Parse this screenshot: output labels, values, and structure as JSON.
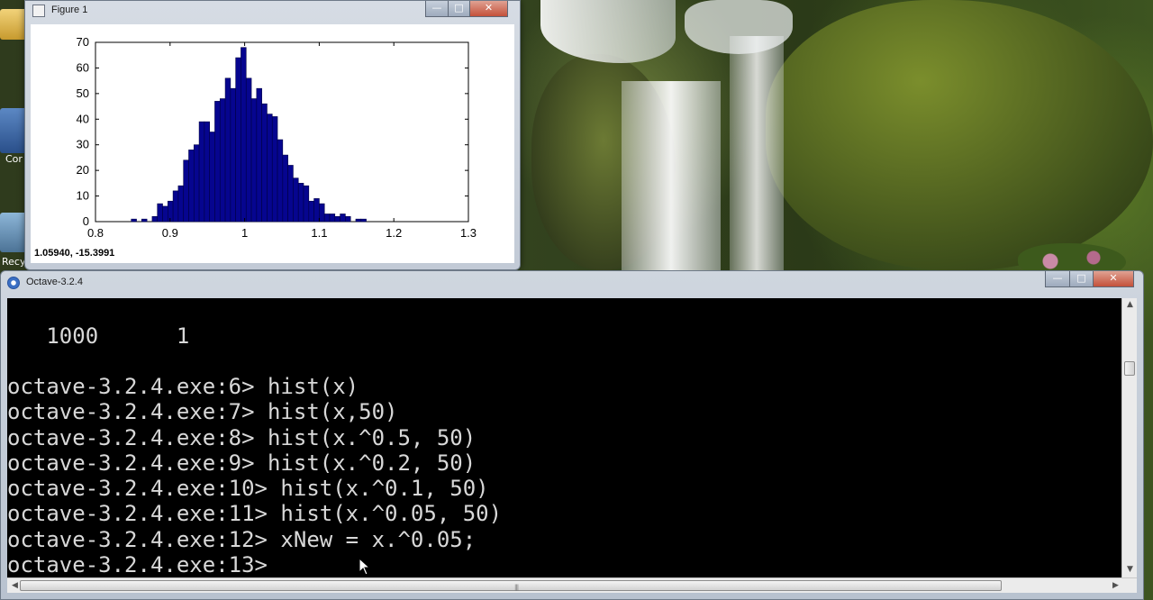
{
  "figure_window": {
    "title": "Figure 1",
    "minimize_glyph": "—",
    "maximize_glyph": "□",
    "close_glyph": "✕",
    "coordinates": "1.05940, -15.3991",
    "icon": "figure-icon"
  },
  "octave_window": {
    "title": "Octave-3.2.4",
    "minimize_glyph": "—",
    "maximize_glyph": "□",
    "close_glyph": "✕",
    "icon": "octave-icon",
    "lines": [
      "   1000      1",
      "",
      "octave-3.2.4.exe:6> hist(x)",
      "octave-3.2.4.exe:7> hist(x,50)",
      "octave-3.2.4.exe:8> hist(x.^0.5, 50)",
      "octave-3.2.4.exe:9> hist(x.^0.2, 50)",
      "octave-3.2.4.exe:10> hist(x.^0.1, 50)",
      "octave-3.2.4.exe:11> hist(x.^0.05, 50)",
      "octave-3.2.4.exe:12> xNew = x.^0.05;",
      "octave-3.2.4.exe:13> "
    ],
    "scroll_up_glyph": "▲",
    "scroll_down_glyph": "▼",
    "scroll_left_glyph": "◀",
    "scroll_right_glyph": "▶",
    "grip_glyph": "|||"
  },
  "desktop": {
    "icon_labels": [
      "Cor",
      "Recy"
    ]
  },
  "colors": {
    "bar_fill": "#06058f",
    "bar_edge": "#000044",
    "terminal_bg": "#000000",
    "terminal_fg": "#d8d8d8"
  },
  "chart_data": {
    "type": "bar",
    "title": "",
    "xlabel": "",
    "ylabel": "",
    "xlim": [
      0.8,
      1.3
    ],
    "ylim": [
      0,
      70
    ],
    "xticks": [
      "0.8",
      "0.9",
      "1",
      "1.1",
      "1.2",
      "1.3"
    ],
    "xtick_values": [
      0.8,
      0.9,
      1.0,
      1.1,
      1.2,
      1.3
    ],
    "yticks": [
      "0",
      "10",
      "20",
      "30",
      "40",
      "50",
      "60",
      "70"
    ],
    "ytick_values": [
      0,
      10,
      20,
      30,
      40,
      50,
      60,
      70
    ],
    "grid": false,
    "bin_start": 0.82,
    "bin_width": 0.007,
    "values": [
      0,
      0,
      0,
      0,
      1,
      0,
      1,
      0,
      2,
      7,
      6,
      8,
      12,
      14,
      24,
      28,
      30,
      39,
      39,
      35,
      47,
      48,
      56,
      52,
      64,
      68,
      56,
      48,
      52,
      46,
      42,
      41,
      32,
      26,
      22,
      17,
      15,
      14,
      8,
      9,
      7,
      3,
      3,
      2,
      3,
      2,
      0,
      1,
      1,
      0,
      0,
      0
    ]
  }
}
